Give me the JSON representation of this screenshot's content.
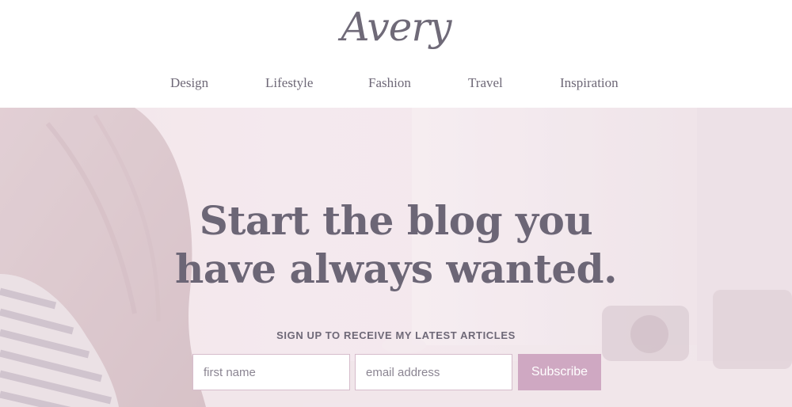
{
  "site": {
    "logo_text": "Avery"
  },
  "nav": {
    "items": [
      {
        "label": "Design"
      },
      {
        "label": "Lifestyle"
      },
      {
        "label": "Fashion"
      },
      {
        "label": "Travel"
      },
      {
        "label": "Inspiration"
      }
    ]
  },
  "hero": {
    "headline_line1": "Start the blog you",
    "headline_line2": "have always wanted.",
    "signup_label": "SIGN UP TO RECEIVE MY LATEST ARTICLES",
    "first_name_placeholder": "first name",
    "email_placeholder": "email address",
    "subscribe_label": "Subscribe"
  },
  "colors": {
    "text": "#6e6877",
    "accent_button": "#cfa8c2",
    "hero_tint": "#f1e6eb",
    "field_border": "#d6bccb"
  }
}
